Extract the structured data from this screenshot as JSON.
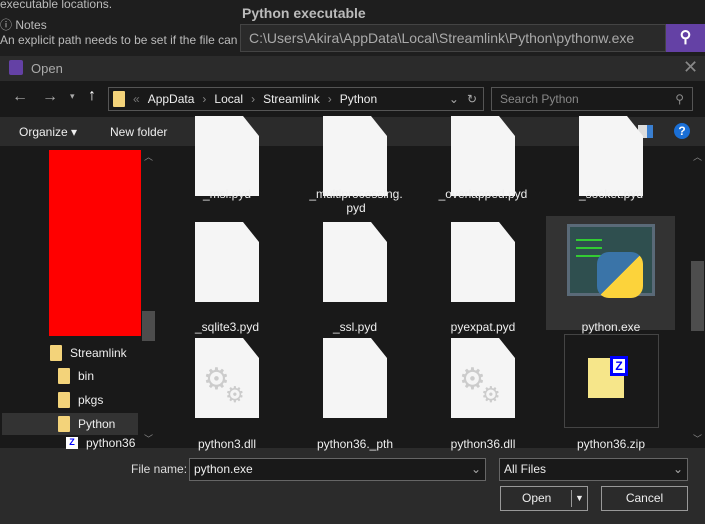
{
  "background": {
    "top_text": "executable locations.",
    "notes_label": "Notes",
    "notes_text": "An explicit path needs to be set if the file can",
    "python_label": "Python executable",
    "python_path": "C:\\Users\\Akira\\AppData\\Local\\Streamlink\\Python\\pythonw.exe",
    "accent": "#6441a5"
  },
  "dialog": {
    "title": "Open",
    "breadcrumb": [
      "AppData",
      "Local",
      "Streamlink",
      "Python"
    ],
    "search_placeholder": "Search Python",
    "toolbar": {
      "organize": "Organize",
      "new_folder": "New folder"
    },
    "tree": [
      {
        "label": "Streamlink"
      },
      {
        "label": "bin"
      },
      {
        "label": "pkgs"
      },
      {
        "label": "Python",
        "selected": true
      },
      {
        "label": "python36"
      }
    ],
    "files": [
      {
        "name": "_msi.pyd",
        "icon": "blank-file"
      },
      {
        "name": "_multiprocessing.pyd",
        "icon": "blank-file"
      },
      {
        "name": "_overlapped.pyd",
        "icon": "blank-file"
      },
      {
        "name": "_socket.pyd",
        "icon": "blank-file"
      },
      {
        "name": "_sqlite3.pyd",
        "icon": "blank-file"
      },
      {
        "name": "_ssl.pyd",
        "icon": "blank-file"
      },
      {
        "name": "pyexpat.pyd",
        "icon": "blank-file"
      },
      {
        "name": "python.exe",
        "icon": "python-exe",
        "selected": true
      },
      {
        "name": "python3.dll",
        "icon": "dll-file"
      },
      {
        "name": "python36._pth",
        "icon": "blank-file"
      },
      {
        "name": "python36.dll",
        "icon": "dll-file"
      },
      {
        "name": "python36.zip",
        "icon": "zip-file"
      }
    ],
    "file_name_label": "File name:",
    "file_name_value": "python.exe",
    "file_type": "All Files",
    "open_label": "Open",
    "cancel_label": "Cancel"
  }
}
